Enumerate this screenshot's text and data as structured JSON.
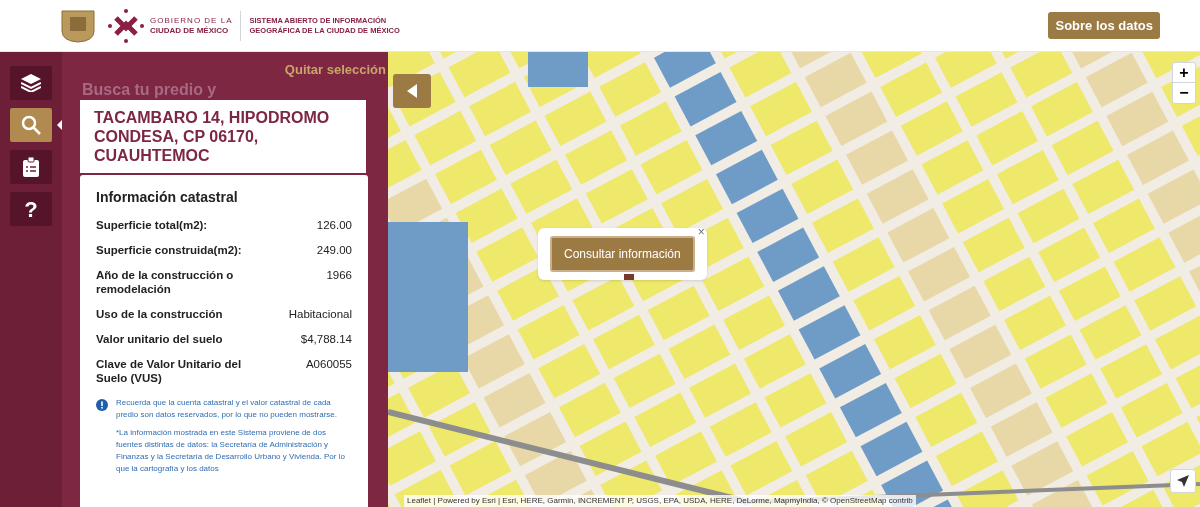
{
  "header": {
    "gov_line1": "GOBIERNO DE LA",
    "gov_line2": "CIUDAD DE MÉXICO",
    "system_line1": "SISTEMA ABIERTO DE INFORMACIÓN",
    "system_line2": "GEOGRÁFICA DE LA CIUDAD DE MÉXICO",
    "about_button": "Sobre los datos"
  },
  "sidebar": {
    "tools": [
      {
        "kind": "layers",
        "selected": false
      },
      {
        "kind": "search",
        "selected": true
      },
      {
        "kind": "clipboard",
        "selected": false
      },
      {
        "kind": "help",
        "label": "?",
        "selected": false
      }
    ]
  },
  "panel": {
    "clear_link": "Quitar selección",
    "heading": "Busca tu predio y",
    "address": "TACAMBARO 14, HIPODROMO CONDESA, CP 06170, CUAUHTEMOC",
    "info_title": "Información catastral",
    "rows": [
      {
        "label": "Superficie total(m2):",
        "value": "126.00"
      },
      {
        "label": "Superficie construida(m2):",
        "value": "249.00"
      },
      {
        "label": "Año de la construcción o remodelación",
        "value": "1966"
      },
      {
        "label": "Uso de la construcción",
        "value": "Habitacional"
      },
      {
        "label": "Valor unitario del suelo",
        "value": "$4,788.14"
      },
      {
        "label": "Clave de Valor Unitario del Suelo (VUS)",
        "value": "A060055"
      }
    ],
    "notice": "Recuerda que la cuenta catastral y el valor catastral de cada predio son datos reservados, por lo que no pueden mostrarse.",
    "disclaimer": "*La información mostrada en este Sistema proviene de dos fuentes distintas de datos: la Secretaría de Administración y Finanzas y la Secretaría de Desarrollo Urbano y Vivienda. Por lo que la cartografía y los datos"
  },
  "map": {
    "popup_button": "Consultar información",
    "popup_close": "×",
    "zoom_in": "+",
    "zoom_out": "−",
    "attribution": "Leaflet | Powered by Esri | Esri, HERE, Garmin, INCREMENT P, USGS, EPA, USDA, HERE, DeLorme, MapmyIndia, © OpenStreetMap contrib"
  }
}
